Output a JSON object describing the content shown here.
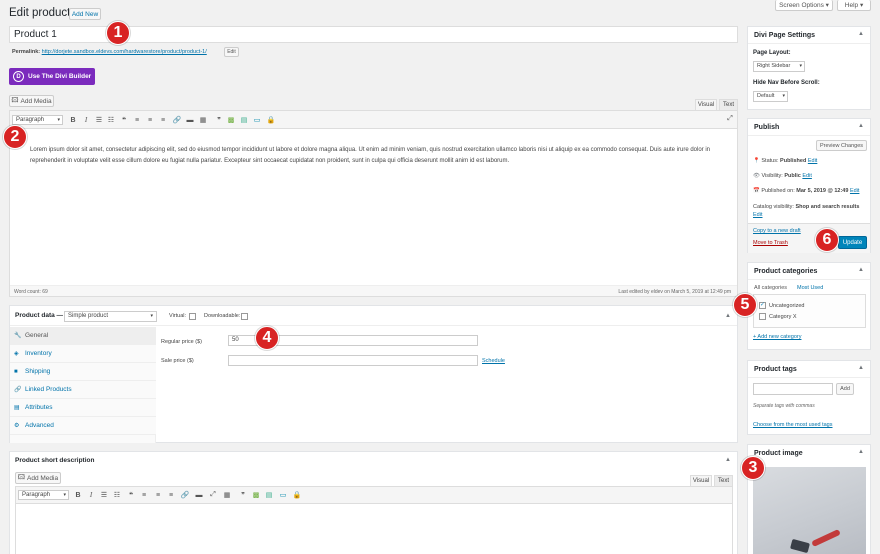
{
  "header": {
    "title": "Edit product",
    "add_new": "Add New",
    "screen_options": "Screen Options ▾",
    "help": "Help ▾"
  },
  "post": {
    "title_value": "Product 1",
    "permalink_label": "Permalink:",
    "permalink_url": "http://dorjete.sandbox.eldevs.com/hardwarestore/product/product-1/",
    "edit": "Edit",
    "divi_button": "Use The Divi Builder"
  },
  "editor": {
    "add_media": "Add Media",
    "tab_visual": "Visual",
    "tab_text": "Text",
    "format": "Paragraph",
    "content": "Lorem ipsum dolor sit amet, consectetur adipiscing elit, sed do eiusmod tempor incididunt ut labore et dolore magna aliqua. Ut enim ad minim veniam, quis nostrud exercitation ullamco laboris nisi ut aliquip ex ea commodo consequat. Duis aute irure dolor in reprehenderit in voluptate velit esse cillum dolore eu fugiat nulla pariatur. Excepteur sint occaecat cupidatat non proident, sunt in culpa qui officia deserunt mollit anim id est laborum.",
    "word_count": "Word count: 69",
    "last_edited": "Last edited by eldev on March 5, 2019 at 12:49 pm"
  },
  "product_data": {
    "label": "Product data —",
    "type": "Simple product",
    "virtual": "Virtual:",
    "downloadable": "Downloadable:",
    "tabs": [
      "General",
      "Inventory",
      "Shipping",
      "Linked Products",
      "Attributes",
      "Advanced"
    ],
    "regular_price_label": "Regular price ($)",
    "regular_price_value": "50",
    "sale_price_label": "Sale price ($)",
    "schedule": "Schedule"
  },
  "short_desc": {
    "title": "Product short description",
    "add_media": "Add Media",
    "tab_visual": "Visual",
    "tab_text": "Text",
    "format": "Paragraph"
  },
  "divi_settings": {
    "title": "Divi Page Settings",
    "layout_label": "Page Layout:",
    "layout_value": "Right Sidebar",
    "hide_nav_label": "Hide Nav Before Scroll:",
    "hide_nav_value": "Default"
  },
  "publish": {
    "title": "Publish",
    "preview": "Preview Changes",
    "status_label": "Status:",
    "status_value": "Published",
    "visibility_label": "Visibility:",
    "visibility_value": "Public",
    "published_on": "Published on:",
    "published_date": "Mar 5, 2019 @ 12:49",
    "catalog_label": "Catalog visibility:",
    "catalog_value": "Shop and search results",
    "edit": "Edit",
    "copy_draft": "Copy to a new draft",
    "move_trash": "Move to Trash",
    "update": "Update"
  },
  "categories": {
    "title": "Product categories",
    "tab_all": "All categories",
    "tab_used": "Most Used",
    "items": [
      "Uncategorized",
      "Category X"
    ],
    "add_new": "+ Add new category"
  },
  "tags": {
    "title": "Product tags",
    "add": "Add",
    "hint": "Separate tags with commas",
    "choose": "Choose from the most used tags"
  },
  "image": {
    "title": "Product image"
  },
  "badges": [
    "1",
    "2",
    "3",
    "4",
    "5",
    "6"
  ],
  "colors": {
    "accent": "#0073aa",
    "divi": "#7b2bbd",
    "badge": "#d82323"
  }
}
